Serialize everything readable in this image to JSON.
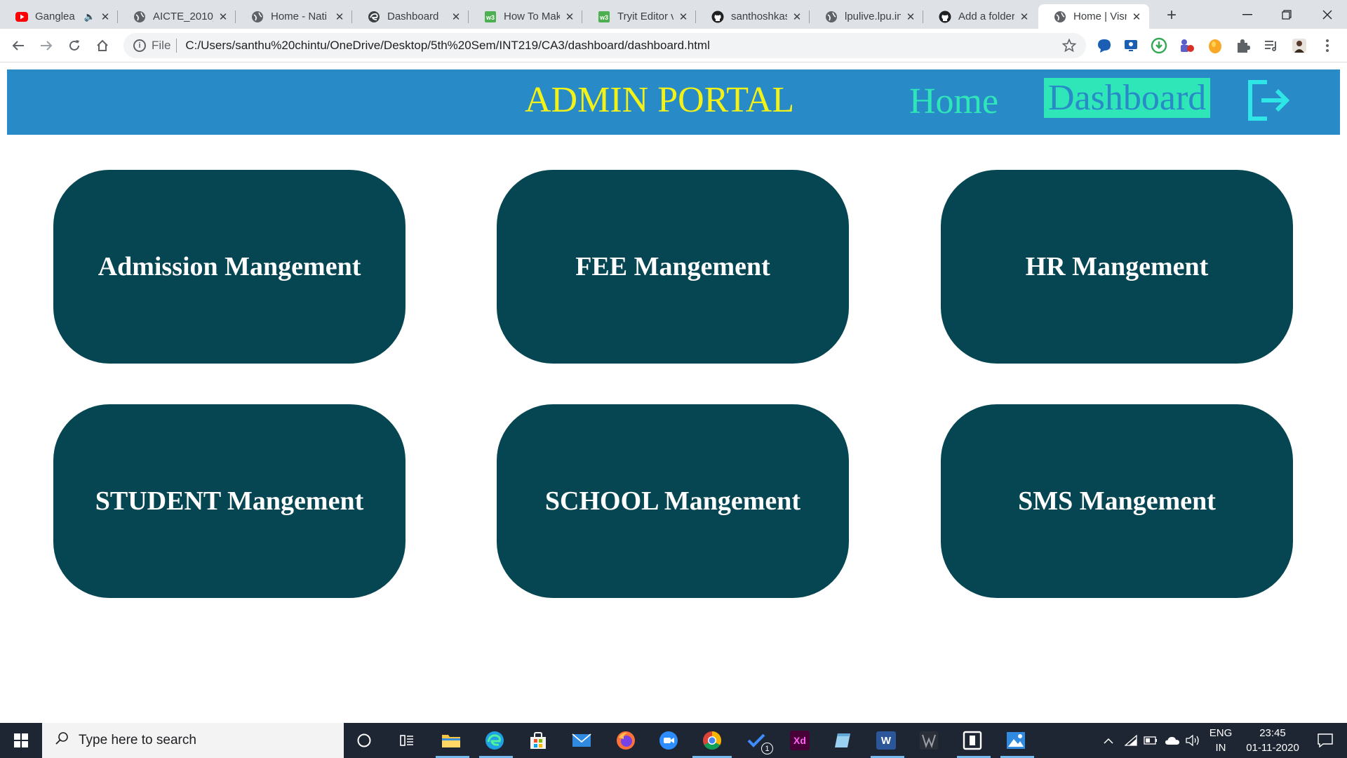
{
  "browser": {
    "tabs": [
      {
        "title": "Ganglea",
        "icon": "youtube-icon"
      },
      {
        "title": "AICTE_2010_",
        "icon": "globe-icon"
      },
      {
        "title": "Home - Nati",
        "icon": "globe-icon"
      },
      {
        "title": "Dashboard",
        "icon": "edge-icon"
      },
      {
        "title": "How To Mak",
        "icon": "w3schools-icon"
      },
      {
        "title": "Tryit Editor v",
        "icon": "w3schools-icon"
      },
      {
        "title": "santhoshkas",
        "icon": "github-icon"
      },
      {
        "title": "lpulive.lpu.in",
        "icon": "globe-icon"
      },
      {
        "title": "Add a folder",
        "icon": "github-icon"
      },
      {
        "title": "Home | Visn",
        "icon": "globe-icon"
      }
    ],
    "address": {
      "scheme": "File",
      "url": "C:/Users/santhu%20chintu/OneDrive/Desktop/5th%20Sem/INT219/CA3/dashboard/dashboard.html"
    }
  },
  "portal": {
    "title": "ADMIN PORTAL",
    "nav": {
      "home": "Home",
      "dashboard": "Dashboard"
    },
    "colors": {
      "header": "#298ac8",
      "title": "#f2f219",
      "nav": "#2ee6b8",
      "card": "#064652"
    },
    "cards": [
      {
        "label": "Admission Mangement"
      },
      {
        "label": "FEE Mangement"
      },
      {
        "label": "HR Mangement"
      },
      {
        "label": "STUDENT Mangement"
      },
      {
        "label": "SCHOOL Mangement"
      },
      {
        "label": "SMS Mangement"
      }
    ]
  },
  "taskbar": {
    "search_placeholder": "Type here to search",
    "language": {
      "line1": "ENG",
      "line2": "IN"
    },
    "clock": {
      "time": "23:45",
      "date": "01-11-2020"
    },
    "todo_badge": "1",
    "xd_label": "Xd",
    "word_label": "W"
  }
}
